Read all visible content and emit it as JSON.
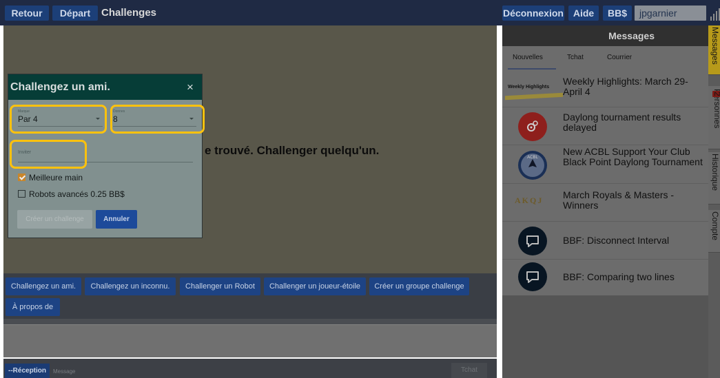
{
  "topbar": {
    "retour": "Retour",
    "depart": "Départ",
    "title": "Challenges",
    "deconnexion": "Déconnexion",
    "aide": "Aide",
    "bbs": "BB$",
    "username": "jpgarnier"
  },
  "main": {
    "empty_message": "e trouvé. Challenger quelqu'un."
  },
  "actions": [
    "Challengez un ami.",
    "Challengez un inconnu.",
    "Challenger un Robot",
    "Challenger un joueur-étoile",
    "Créer un groupe challenge",
    "À propos de"
  ],
  "bottom": {
    "reception": "--Réception",
    "message_placeholder": "Message",
    "tchat": "Tchat"
  },
  "modal": {
    "title": "Challengez un ami.",
    "close": "×",
    "field1_label": "Marque",
    "field1_value": "Par 4",
    "field2_label": "Donnes",
    "field2_value": "8",
    "invite_label": "Inviter",
    "best_hand_label": "Meilleure main",
    "best_hand_checked": true,
    "robots_label": "Robots avancés 0.25 BB$",
    "robots_checked": false,
    "create_button": "Créer un challenge",
    "cancel_button": "Annuler"
  },
  "messages": {
    "header": "Messages",
    "tabs": [
      "Nouvelles",
      "Tchat",
      "Courrier"
    ],
    "active_tab": "Nouvelles",
    "items": [
      {
        "icon": "weekly-highlights-logo",
        "icon_text": "Weekly Highlights",
        "text": "Weekly Highlights: March 29-April 4"
      },
      {
        "icon": "gears-icon",
        "text": "Daylong tournament results delayed"
      },
      {
        "icon": "acbl-logo",
        "icon_text": "ACBL",
        "text": "New ACBL Support Your Club Black Point Daylong Tournament"
      },
      {
        "icon": "akqj-logo",
        "icon_text": "AKQJ",
        "text": "March Royals & Masters - Winners"
      },
      {
        "icon": "chat-bubble-icon",
        "text": "BBF: Disconnect Interval"
      },
      {
        "icon": "chat-bubble-icon",
        "text": "BBF: Comparing two lines"
      }
    ]
  },
  "side_tabs": {
    "messages": "Messages",
    "personnes": "Personnes",
    "personnes_badge": "2",
    "historique": "Historique",
    "compte": "Compte"
  },
  "colors": {
    "highlight": "#ffc20e",
    "topbar_button": "#1c3f78",
    "modal_header": "#063d37",
    "active_side_tab": "#b79a1a"
  }
}
